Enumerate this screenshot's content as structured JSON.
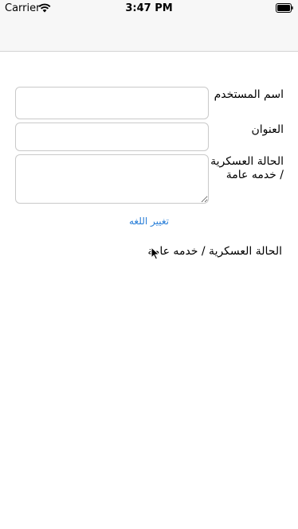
{
  "status_bar": {
    "carrier": "Carrier",
    "time": "3:47 PM",
    "icons": [
      "wifi-icon",
      "battery-icon"
    ]
  },
  "form": {
    "username_label": "اسم المستخدم",
    "username_value": "",
    "address_label": "العنوان",
    "address_value": "",
    "military_status_label": "الحالة العسكرية / خدمه عامة",
    "military_status_value": ""
  },
  "change_language_button": "تغيير اللغه",
  "result_label": "الحالة العسكرية / خدمه عامة",
  "colors": {
    "link": "#2a7fd8",
    "field_border": "#c9c9c9",
    "bar_background": "#f7f7f7"
  }
}
